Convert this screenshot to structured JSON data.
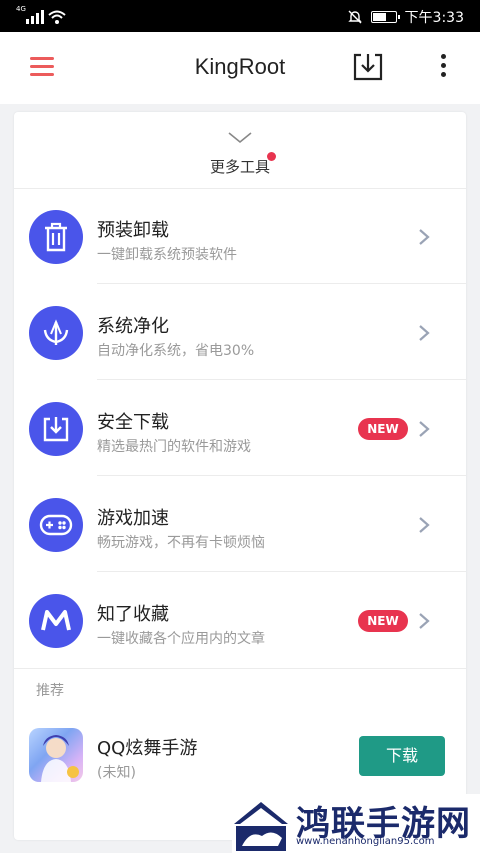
{
  "status_bar": {
    "network": "4G",
    "time": "下午3:33"
  },
  "header": {
    "title": "KingRoot"
  },
  "more_tools": {
    "label": "更多工具"
  },
  "tools": [
    {
      "title": "预装卸载",
      "subtitle": "一键卸载系统预装软件",
      "icon": "trash-icon"
    },
    {
      "title": "系统净化",
      "subtitle": "自动净化系统，省电30%",
      "icon": "trident-icon"
    },
    {
      "title": "安全下载",
      "subtitle": "精选最热门的软件和游戏",
      "icon": "download-box-icon",
      "badge": "NEW"
    },
    {
      "title": "游戏加速",
      "subtitle": "畅玩游戏，不再有卡顿烦恼",
      "icon": "gamepad-icon"
    },
    {
      "title": "知了收藏",
      "subtitle": "一键收藏各个应用内的文章",
      "icon": "m-logo-icon",
      "badge": "NEW"
    }
  ],
  "recommend": {
    "label": "推荐",
    "app": {
      "name": "QQ炫舞手游",
      "size": "(未知)",
      "action": "下载"
    }
  },
  "watermark": {
    "text": "鸿联手游网",
    "url": "www.henanhonglian95.com"
  },
  "colors": {
    "accent_blue": "#4a55ea",
    "badge_red": "#e8344f",
    "menu_red": "#ec5b5b",
    "download_green": "#1f9a86"
  }
}
